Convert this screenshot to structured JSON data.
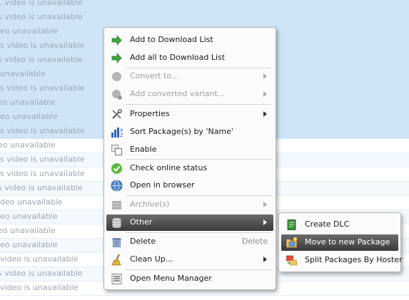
{
  "background_rows": [
    {
      "text": "...video is unavailable",
      "selected": true
    },
    {
      "text": "s video is unavailable",
      "selected": true
    },
    {
      "text": "eo unavailable",
      "selected": true
    },
    {
      "text": "s video is unavailable",
      "selected": true
    },
    {
      "text": "s video is unavailable",
      "selected": true
    },
    {
      "text": "unavailable",
      "selected": true
    },
    {
      "text": "s video is unavailable",
      "selected": true
    },
    {
      "text": "eo unavailable",
      "selected": true
    },
    {
      "text": "eo unavailable",
      "selected": true
    },
    {
      "text": "s video is unavailable",
      "selected": true
    },
    {
      "text": "eo unavailable",
      "selected": false
    },
    {
      "text": "s video is unavailable",
      "selected": false
    },
    {
      "text": "s video is unavailable",
      "selected": false
    },
    {
      "text": "s video is unavailable",
      "selected": false
    },
    {
      "text": "deo unavailable",
      "selected": false
    },
    {
      "text": "eo unavailable",
      "selected": false
    },
    {
      "text": "eo unavailable",
      "selected": false
    },
    {
      "text": "eo unavailable",
      "selected": false
    },
    {
      "text": "video is unavailable",
      "selected": false
    },
    {
      "text": "s video is unavailable",
      "selected": false
    },
    {
      "text": "video is unavailable",
      "selected": false
    }
  ],
  "menu": {
    "add_download": "Add to Download List",
    "add_all_download": "Add all to Download List",
    "convert_to": "Convert to...",
    "add_converted": "Add converted variant...",
    "properties": "Properties",
    "sort_packages": "Sort Package(s) by 'Name'",
    "enable": "Enable",
    "check_online": "Check online status",
    "open_browser": "Open in browser",
    "archives": "Archive(s)",
    "other": "Other",
    "delete": "Delete",
    "delete_shortcut": "Delete",
    "clean_up": "Clean Up...",
    "open_menu_manager": "Open Menu Manager"
  },
  "submenu": {
    "create_dlc": "Create DLC",
    "move_new_package": "Move to new Package",
    "split_packages": "Split Packages By Hoster"
  },
  "colors": {
    "selection_bg": "#cfe5f7",
    "highlight_dark": "#4a4a4a",
    "green_arrow": "#3ea63a"
  }
}
